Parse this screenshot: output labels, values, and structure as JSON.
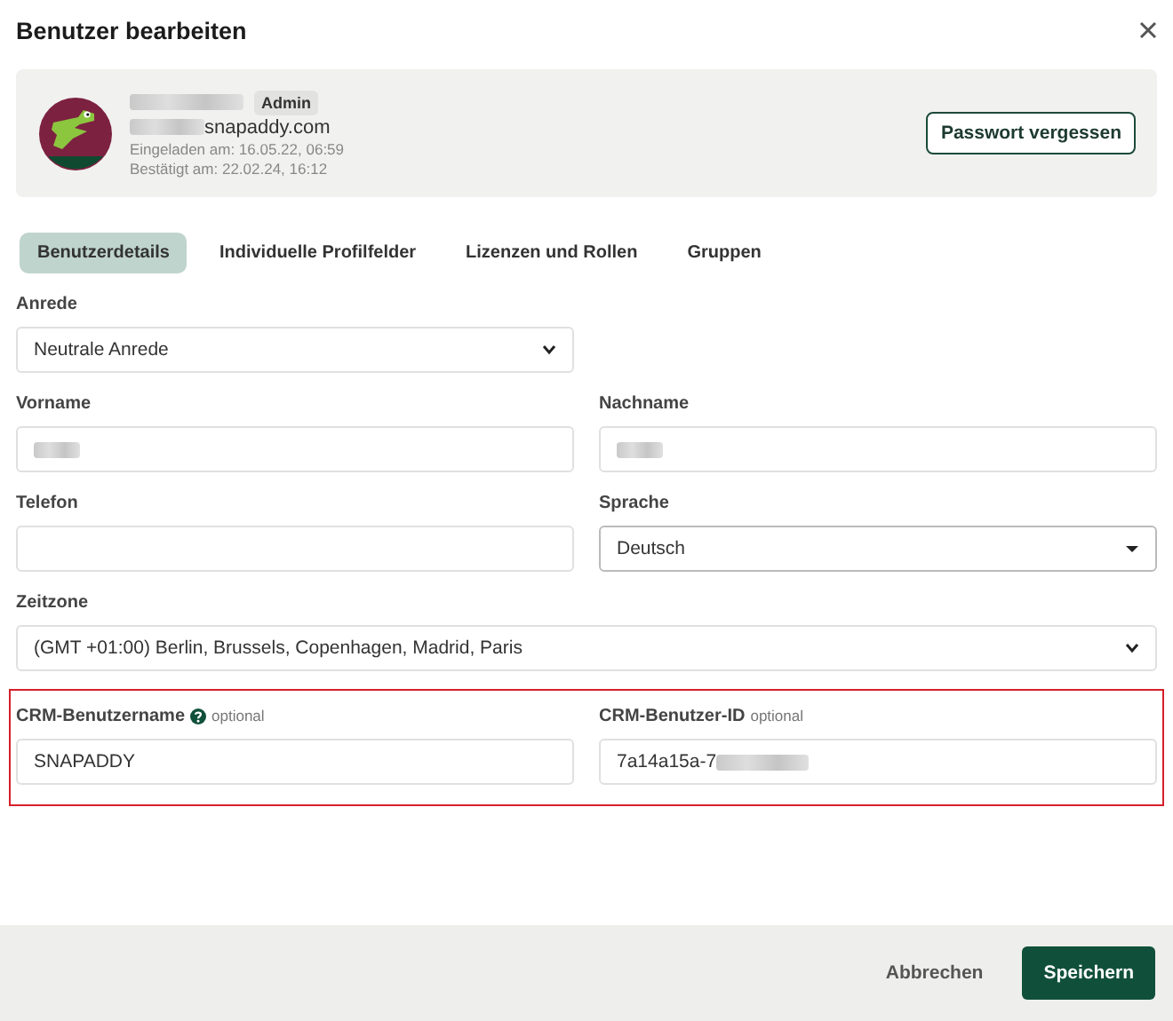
{
  "dialog": {
    "title": "Benutzer bearbeiten"
  },
  "user_card": {
    "role_badge": "Admin",
    "email_domain": "snapaddy.com",
    "invited": "Eingeladen am: 16.05.22, 06:59",
    "confirmed": "Bestätigt am: 22.02.24, 16:12",
    "button": "Passwort vergessen"
  },
  "tabs": [
    {
      "label": "Benutzerdetails",
      "selected": true
    },
    {
      "label": "Individuelle Profilfelder",
      "selected": false
    },
    {
      "label": "Lizenzen und Rollen",
      "selected": false
    },
    {
      "label": "Gruppen",
      "selected": false
    }
  ],
  "form_rows": [
    {
      "highlighted": false,
      "fields": [
        {
          "kind": "select",
          "label": "Anrede",
          "value": "Neutrale Anrede"
        }
      ]
    },
    {
      "highlighted": false,
      "fields": [
        {
          "kind": "input",
          "label": "Vorname",
          "redacted": true
        },
        {
          "kind": "input",
          "label": "Nachname",
          "redacted": true
        }
      ]
    },
    {
      "highlighted": false,
      "fields": [
        {
          "kind": "input",
          "label": "Telefon"
        },
        {
          "kind": "dropdown",
          "label": "Sprache",
          "value": "Deutsch"
        }
      ]
    },
    {
      "highlighted": false,
      "full": true,
      "fields": [
        {
          "kind": "select",
          "label": "Zeitzone",
          "value": "(GMT +01:00) Berlin, Brussels, Copenhagen, Madrid, Paris"
        }
      ]
    },
    {
      "highlighted": true,
      "fields": [
        {
          "kind": "input",
          "label": "CRM-Benutzername",
          "help": true,
          "note": "optional",
          "value": "SNAPADDY"
        },
        {
          "kind": "input",
          "label": "CRM-Benutzer-ID",
          "note": "optional",
          "value": "7a14a15a-7",
          "redacted": true
        }
      ]
    }
  ],
  "footer": {
    "buttons": [
      {
        "kind": "secondary",
        "label": "Abbrechen"
      },
      {
        "kind": "primary",
        "label": "Speichern"
      }
    ]
  }
}
